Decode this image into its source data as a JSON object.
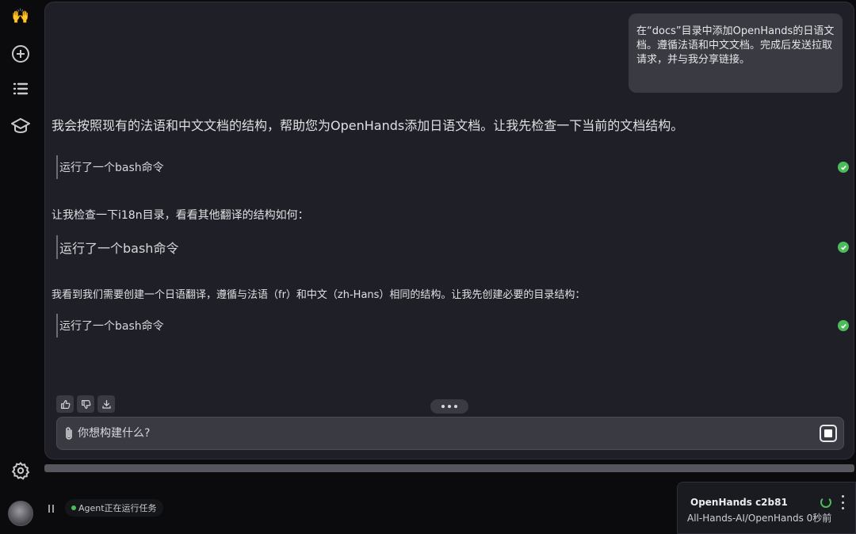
{
  "sidebar": {
    "logo_glyph": "🙌",
    "icons": [
      "hands-logo-icon",
      "add-icon",
      "list-icon",
      "graduation-cap-icon",
      "gear-icon"
    ]
  },
  "chat": {
    "user_message": "在“docs”目录中添加OpenHands的日语文档。遵循法语和中文文档。完成后发送拉取请求，并与我分享链接。",
    "messages": [
      "我会按照现有的法语和中文文档的结构，帮助您为OpenHands添加日语文档。让我先检查一下当前的文档结构。",
      "让我检查一下i18n目录，看看其他翻译的结构如何：",
      "我看到我们需要创建一个日语翻译，遵循与法语（fr）和中文（zh-Hans）相同的结构。让我先创建必要的目录结构："
    ],
    "actions": [
      {
        "label": "运行了一个bash命令",
        "status": "success"
      },
      {
        "label": "运行了一个bash命令",
        "status": "success"
      },
      {
        "label": "运行了一个bash命令",
        "status": "success"
      }
    ]
  },
  "composer": {
    "placeholder": "你想构建什么?"
  },
  "status": {
    "agent_text": "Agent正在运行任务"
  },
  "repo": {
    "title": "OpenHands c2b81",
    "subtitle": "All-Hands-AI/OpenHands 0秒前"
  },
  "colors": {
    "success": "#4cbb5b",
    "panel": "#1f2027",
    "bubble": "#3a3b42"
  }
}
